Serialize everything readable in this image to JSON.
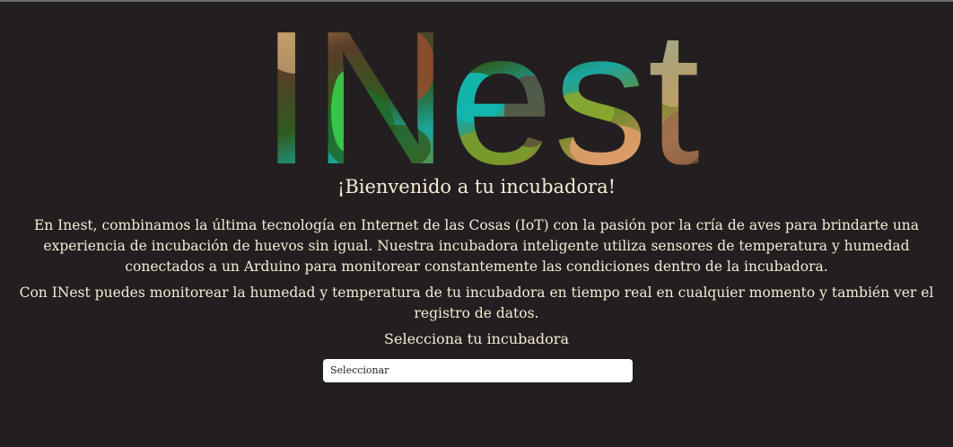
{
  "logo": {
    "text": "INest"
  },
  "welcome": "¡Bienvenido a tu incubadora!",
  "intro_paragraph": "En Inest, combinamos la última tecnología en Internet de las Cosas (IoT) con la pasión por la cría de aves para brindarte una experiencia de incubación de huevos sin igual. Nuestra incubadora inteligente utiliza sensores de temperatura y humedad conectados a un Arduino para monitorear constantemente las condiciones dentro de la incubadora.",
  "monitor_paragraph": "Con INest puedes monitorear la humedad y temperatura de tu incubadora en tiempo real en cualquier momento y también ver el registro de datos.",
  "selector": {
    "label": "Selecciona tu incubadora",
    "selected": "Seleccionar"
  },
  "colors": {
    "background": "#231f20",
    "text": "#f5ebd6"
  }
}
